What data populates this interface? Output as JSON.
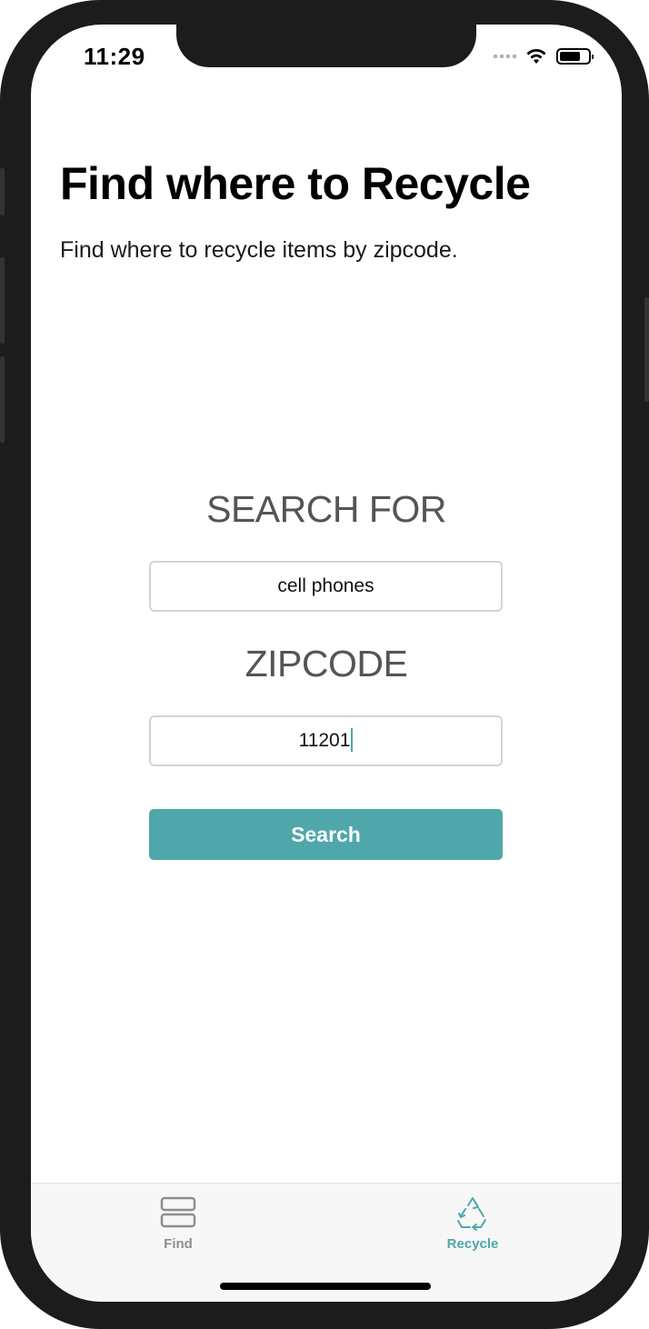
{
  "status_bar": {
    "time": "11:29",
    "icons": [
      "signal-dots-icon",
      "wifi-icon",
      "battery-icon"
    ]
  },
  "header": {
    "title": "Find where to Recycle",
    "subtitle": "Find where to recycle items by zipcode."
  },
  "form": {
    "search_label": "SEARCH FOR",
    "search_value": "cell phones",
    "zip_label": "ZIPCODE",
    "zip_value": "11201",
    "button_label": "Search"
  },
  "tab_bar": {
    "tabs": [
      {
        "label": "Find",
        "icon": "list-icon",
        "active": false
      },
      {
        "label": "Recycle",
        "icon": "recycle-icon",
        "active": true
      }
    ]
  },
  "colors": {
    "accent": "#4fa7ab",
    "inactive_tab": "#8e8e8e",
    "label_gray": "#555555"
  }
}
